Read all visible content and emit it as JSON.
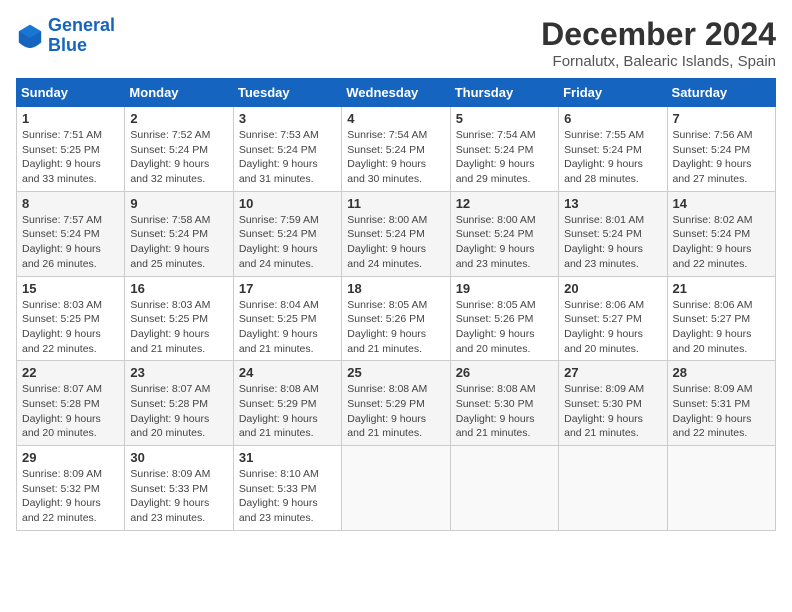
{
  "logo": {
    "line1": "General",
    "line2": "Blue"
  },
  "title": "December 2024",
  "subtitle": "Fornalutx, Balearic Islands, Spain",
  "headers": [
    "Sunday",
    "Monday",
    "Tuesday",
    "Wednesday",
    "Thursday",
    "Friday",
    "Saturday"
  ],
  "weeks": [
    [
      {
        "day": "1",
        "info": "Sunrise: 7:51 AM\nSunset: 5:25 PM\nDaylight: 9 hours and 33 minutes."
      },
      {
        "day": "2",
        "info": "Sunrise: 7:52 AM\nSunset: 5:24 PM\nDaylight: 9 hours and 32 minutes."
      },
      {
        "day": "3",
        "info": "Sunrise: 7:53 AM\nSunset: 5:24 PM\nDaylight: 9 hours and 31 minutes."
      },
      {
        "day": "4",
        "info": "Sunrise: 7:54 AM\nSunset: 5:24 PM\nDaylight: 9 hours and 30 minutes."
      },
      {
        "day": "5",
        "info": "Sunrise: 7:54 AM\nSunset: 5:24 PM\nDaylight: 9 hours and 29 minutes."
      },
      {
        "day": "6",
        "info": "Sunrise: 7:55 AM\nSunset: 5:24 PM\nDaylight: 9 hours and 28 minutes."
      },
      {
        "day": "7",
        "info": "Sunrise: 7:56 AM\nSunset: 5:24 PM\nDaylight: 9 hours and 27 minutes."
      }
    ],
    [
      {
        "day": "8",
        "info": "Sunrise: 7:57 AM\nSunset: 5:24 PM\nDaylight: 9 hours and 26 minutes."
      },
      {
        "day": "9",
        "info": "Sunrise: 7:58 AM\nSunset: 5:24 PM\nDaylight: 9 hours and 25 minutes."
      },
      {
        "day": "10",
        "info": "Sunrise: 7:59 AM\nSunset: 5:24 PM\nDaylight: 9 hours and 24 minutes."
      },
      {
        "day": "11",
        "info": "Sunrise: 8:00 AM\nSunset: 5:24 PM\nDaylight: 9 hours and 24 minutes."
      },
      {
        "day": "12",
        "info": "Sunrise: 8:00 AM\nSunset: 5:24 PM\nDaylight: 9 hours and 23 minutes."
      },
      {
        "day": "13",
        "info": "Sunrise: 8:01 AM\nSunset: 5:24 PM\nDaylight: 9 hours and 23 minutes."
      },
      {
        "day": "14",
        "info": "Sunrise: 8:02 AM\nSunset: 5:24 PM\nDaylight: 9 hours and 22 minutes."
      }
    ],
    [
      {
        "day": "15",
        "info": "Sunrise: 8:03 AM\nSunset: 5:25 PM\nDaylight: 9 hours and 22 minutes."
      },
      {
        "day": "16",
        "info": "Sunrise: 8:03 AM\nSunset: 5:25 PM\nDaylight: 9 hours and 21 minutes."
      },
      {
        "day": "17",
        "info": "Sunrise: 8:04 AM\nSunset: 5:25 PM\nDaylight: 9 hours and 21 minutes."
      },
      {
        "day": "18",
        "info": "Sunrise: 8:05 AM\nSunset: 5:26 PM\nDaylight: 9 hours and 21 minutes."
      },
      {
        "day": "19",
        "info": "Sunrise: 8:05 AM\nSunset: 5:26 PM\nDaylight: 9 hours and 20 minutes."
      },
      {
        "day": "20",
        "info": "Sunrise: 8:06 AM\nSunset: 5:27 PM\nDaylight: 9 hours and 20 minutes."
      },
      {
        "day": "21",
        "info": "Sunrise: 8:06 AM\nSunset: 5:27 PM\nDaylight: 9 hours and 20 minutes."
      }
    ],
    [
      {
        "day": "22",
        "info": "Sunrise: 8:07 AM\nSunset: 5:28 PM\nDaylight: 9 hours and 20 minutes."
      },
      {
        "day": "23",
        "info": "Sunrise: 8:07 AM\nSunset: 5:28 PM\nDaylight: 9 hours and 20 minutes."
      },
      {
        "day": "24",
        "info": "Sunrise: 8:08 AM\nSunset: 5:29 PM\nDaylight: 9 hours and 21 minutes."
      },
      {
        "day": "25",
        "info": "Sunrise: 8:08 AM\nSunset: 5:29 PM\nDaylight: 9 hours and 21 minutes."
      },
      {
        "day": "26",
        "info": "Sunrise: 8:08 AM\nSunset: 5:30 PM\nDaylight: 9 hours and 21 minutes."
      },
      {
        "day": "27",
        "info": "Sunrise: 8:09 AM\nSunset: 5:30 PM\nDaylight: 9 hours and 21 minutes."
      },
      {
        "day": "28",
        "info": "Sunrise: 8:09 AM\nSunset: 5:31 PM\nDaylight: 9 hours and 22 minutes."
      }
    ],
    [
      {
        "day": "29",
        "info": "Sunrise: 8:09 AM\nSunset: 5:32 PM\nDaylight: 9 hours and 22 minutes."
      },
      {
        "day": "30",
        "info": "Sunrise: 8:09 AM\nSunset: 5:33 PM\nDaylight: 9 hours and 23 minutes."
      },
      {
        "day": "31",
        "info": "Sunrise: 8:10 AM\nSunset: 5:33 PM\nDaylight: 9 hours and 23 minutes."
      },
      null,
      null,
      null,
      null
    ]
  ]
}
